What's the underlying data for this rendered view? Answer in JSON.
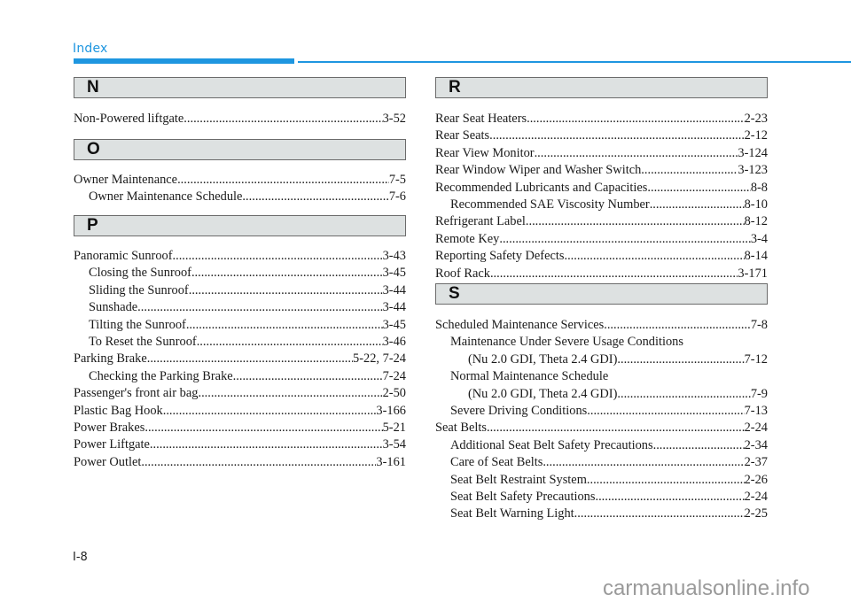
{
  "header": {
    "title": "Index",
    "accent_color": "#1e96e0"
  },
  "left_column": {
    "sections": [
      {
        "letter": "N",
        "entries": [
          {
            "label": "Non-Powered liftgate ",
            "page": "3-52",
            "level": 1
          }
        ]
      },
      {
        "letter": "O",
        "entries": [
          {
            "label": "Owner Maintenance ",
            "page": "7-5",
            "level": 1
          },
          {
            "label": "Owner Maintenance Schedule",
            "page": "7-6",
            "level": 2
          }
        ]
      },
      {
        "letter": "P",
        "entries": [
          {
            "label": "Panoramic Sunroof ",
            "page": "3-43",
            "level": 1
          },
          {
            "label": "Closing the Sunroof",
            "page": "3-45",
            "level": 2
          },
          {
            "label": "Sliding the Sunroof ",
            "page": "3-44",
            "level": 2
          },
          {
            "label": "Sunshade",
            "page": "3-44",
            "level": 2
          },
          {
            "label": "Tilting the Sunroof ",
            "page": "3-45",
            "level": 2
          },
          {
            "label": "To Reset the Sunroof",
            "page": "3-46",
            "level": 2
          },
          {
            "label": "Parking Brake ",
            "page": "5-22, 7-24",
            "level": 1
          },
          {
            "label": "Checking the Parking Brake ",
            "page": "7-24",
            "level": 2
          },
          {
            "label": "Passenger's front air bag ",
            "page": "2-50",
            "level": 1
          },
          {
            "label": "Plastic Bag Hook ",
            "page": "3-166",
            "level": 1
          },
          {
            "label": "Power Brakes ",
            "page": "5-21",
            "level": 1
          },
          {
            "label": "Power Liftgate",
            "page": "3-54",
            "level": 1
          },
          {
            "label": "Power Outlet ",
            "page": "3-161",
            "level": 1
          }
        ]
      }
    ]
  },
  "right_column": {
    "sections": [
      {
        "letter": "R",
        "entries": [
          {
            "label": "Rear Seat Heaters",
            "page": "2-23",
            "level": 1
          },
          {
            "label": "Rear Seats ",
            "page": "2-12",
            "level": 1
          },
          {
            "label": "Rear View Monitor ",
            "page": "3-124",
            "level": 1
          },
          {
            "label": "Rear Window Wiper and Washer Switch ",
            "page": "3-123",
            "level": 1
          },
          {
            "label": "Recommended Lubricants and Capacities",
            "page": "8-8",
            "level": 1
          },
          {
            "label": "Recommended SAE Viscosity Number ",
            "page": "8-10",
            "level": 2
          },
          {
            "label": "Refrigerant Label ",
            "page": "8-12",
            "level": 1
          },
          {
            "label": "Remote Key ",
            "page": "3-4",
            "level": 1
          },
          {
            "label": "Reporting Safety Defects",
            "page": "8-14",
            "level": 1
          },
          {
            "label": "Roof Rack ",
            "page": "3-171",
            "level": 1
          }
        ]
      },
      {
        "letter": "S",
        "entries": [
          {
            "label": "Scheduled Maintenance Services ",
            "page": "7-8",
            "level": 1
          },
          {
            "label": "Maintenance Under Severe Usage Conditions",
            "page": "",
            "level": 2
          },
          {
            "label": "(Nu 2.0 GDI, Theta 2.4 GDI) ",
            "page": "7-12",
            "level": 3
          },
          {
            "label": "Normal Maintenance Schedule",
            "page": "",
            "level": 2
          },
          {
            "label": "(Nu 2.0 GDI, Theta 2.4 GDI) ",
            "page": "7-9",
            "level": 3
          },
          {
            "label": "Severe Driving Conditions",
            "page": "7-13",
            "level": 2
          },
          {
            "label": "Seat Belts ",
            "page": "2-24",
            "level": 1
          },
          {
            "label": "Additional Seat Belt Safety Precautions ",
            "page": "2-34",
            "level": 2
          },
          {
            "label": "Care of Seat Belts",
            "page": "2-37",
            "level": 2
          },
          {
            "label": "Seat Belt Restraint System ",
            "page": "2-26",
            "level": 2
          },
          {
            "label": "Seat Belt Safety Precautions ",
            "page": "2-24",
            "level": 2
          },
          {
            "label": "Seat Belt Warning Light",
            "page": "2-25",
            "level": 2
          }
        ]
      }
    ]
  },
  "footer": {
    "page_number": "I-8",
    "watermark": "carmanualsonline.info"
  }
}
